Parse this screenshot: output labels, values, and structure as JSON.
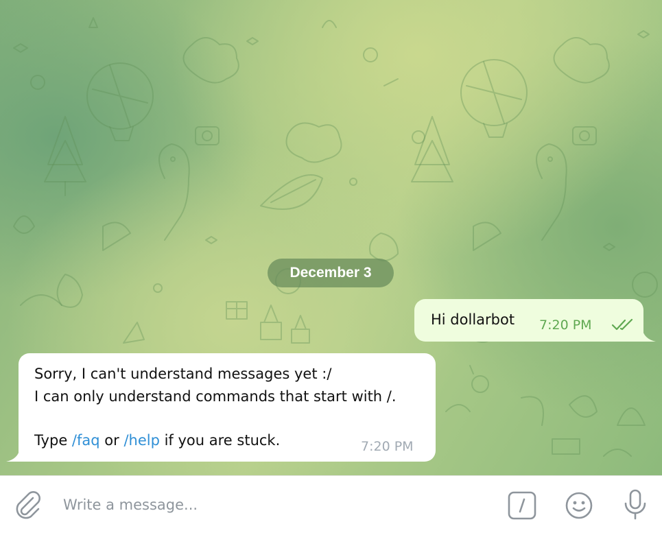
{
  "date_separator": "December 3",
  "messages": [
    {
      "direction": "outgoing",
      "text": "Hi dollarbot",
      "time": "7:20 PM",
      "status_icon": "double-check-icon"
    },
    {
      "direction": "incoming",
      "line1": "Sorry, I can't understand messages yet :/",
      "line2": "I can only understand commands that start with /.",
      "line4_pre": "Type ",
      "cmd1": "/faq",
      "line4_mid": " or ",
      "cmd2": "/help",
      "line4_post": " if you are stuck.",
      "time": "7:20 PM"
    }
  ],
  "composer": {
    "placeholder": "Write a message...",
    "attach_icon": "paperclip-icon",
    "command_icon": "slash-command-icon",
    "emoji_icon": "smiley-icon",
    "mic_icon": "microphone-icon"
  },
  "colors": {
    "outgoing_bubble": "#effdde",
    "outgoing_time": "#5fa851",
    "incoming_bubble": "#ffffff",
    "incoming_time": "#a1aab3",
    "link": "#2f8fd6",
    "icon_gray": "#8e959c"
  }
}
